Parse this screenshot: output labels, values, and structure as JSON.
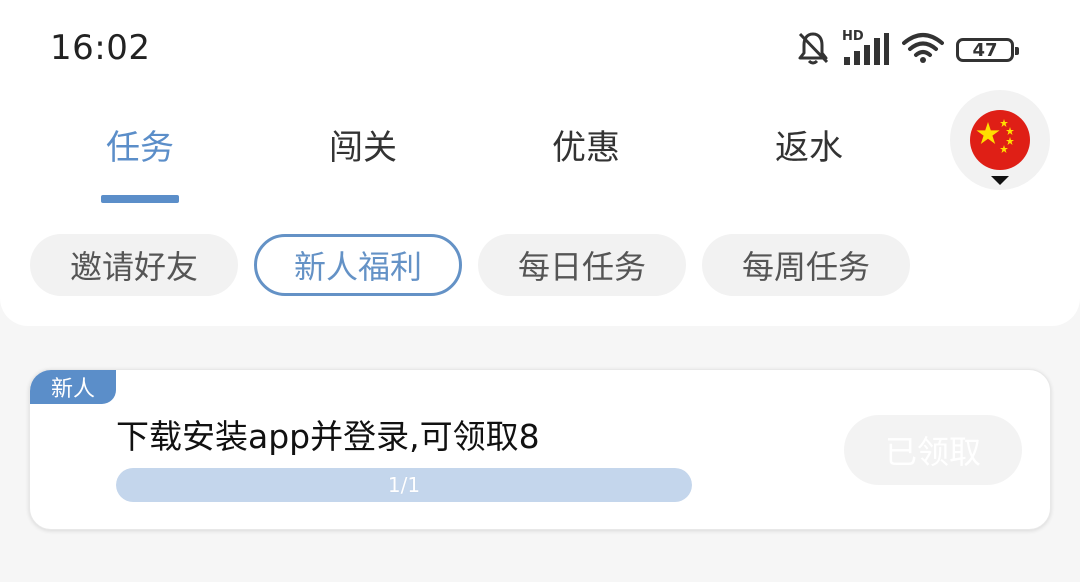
{
  "status_bar": {
    "time": "16:02",
    "network_label": "HD",
    "battery": "47",
    "icons": [
      "bell-muted-icon",
      "signal-icon",
      "wifi-icon",
      "battery-icon"
    ]
  },
  "tabs": [
    {
      "label": "任务",
      "active": true
    },
    {
      "label": "闯关",
      "active": false
    },
    {
      "label": "优惠",
      "active": false
    },
    {
      "label": "返水",
      "active": false
    }
  ],
  "language_selector": {
    "icon": "china-flag-icon"
  },
  "sub_tabs": [
    {
      "label": "邀请好友",
      "active": false
    },
    {
      "label": "新人福利",
      "active": true
    },
    {
      "label": "每日任务",
      "active": false
    },
    {
      "label": "每周任务",
      "active": false
    }
  ],
  "task_card": {
    "tag": "新人",
    "title": "下载安装app并登录,可领取8",
    "progress_text": "1/1",
    "progress": 1.0,
    "button_label": "已领取"
  },
  "colors": {
    "accent": "#5b8ec9",
    "progress_fill": "#c4d6ec",
    "flag_red": "#df1f16",
    "flag_star": "#ffde00"
  }
}
